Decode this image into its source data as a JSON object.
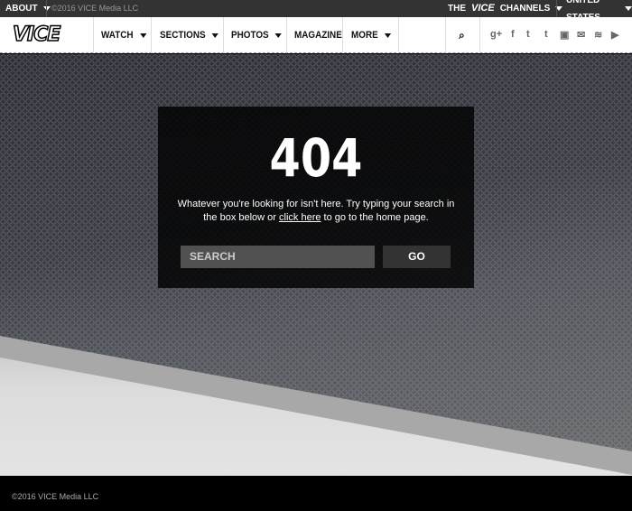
{
  "topbar": {
    "about": "ABOUT",
    "copyright": "©2016 VICE Media LLC",
    "channels_prefix": "THE",
    "channels_logo": "VICE",
    "channels": "CHANNELS",
    "region": "UNITED STATES"
  },
  "nav": {
    "logo": "VICE",
    "items": [
      {
        "label": "WATCH"
      },
      {
        "label": "SECTIONS"
      },
      {
        "label": "PHOTOS"
      },
      {
        "label": "MAGAZINE"
      },
      {
        "label": "MORE"
      }
    ],
    "social": [
      "google-plus-icon",
      "facebook-icon",
      "twitter-icon",
      "tumblr-icon",
      "instagram-icon",
      "email-icon",
      "rss-icon",
      "youtube-icon"
    ]
  },
  "error": {
    "code": "404",
    "msg_before": "Whatever you're looking for isn't here. Try typing your search in the box below or ",
    "link": "click here",
    "msg_after": " to go to the home page.",
    "search_placeholder": "SEARCH",
    "go": "GO"
  },
  "footer": {
    "copyright": "©2016 VICE Media LLC"
  }
}
